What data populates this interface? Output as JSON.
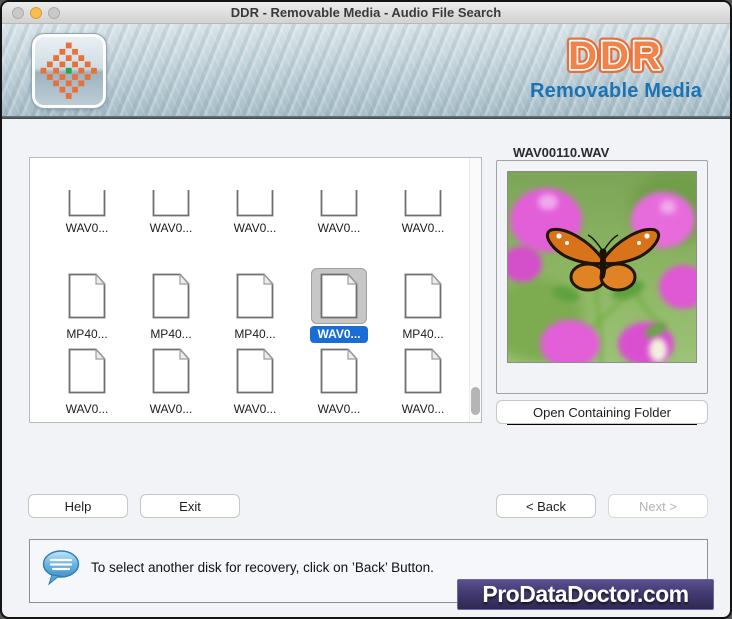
{
  "window": {
    "title": "DDR - Removable Media - Audio File Search"
  },
  "header": {
    "brand": "DDR",
    "subtitle": "Removable Media"
  },
  "file_grid": {
    "rows": [
      {
        "partial": true,
        "items": [
          {
            "label": "WAV0..."
          },
          {
            "label": "WAV0..."
          },
          {
            "label": "WAV0..."
          },
          {
            "label": "WAV0..."
          },
          {
            "label": "WAV0..."
          }
        ]
      },
      {
        "partial": false,
        "items": [
          {
            "label": "MP40..."
          },
          {
            "label": "MP40..."
          },
          {
            "label": "MP40..."
          },
          {
            "label": "WAV0...",
            "selected": true
          },
          {
            "label": "MP40..."
          }
        ]
      },
      {
        "partial": false,
        "items": [
          {
            "label": "WAV0..."
          },
          {
            "label": "WAV0..."
          },
          {
            "label": "WAV0..."
          },
          {
            "label": "WAV0..."
          },
          {
            "label": "WAV0..."
          }
        ]
      }
    ]
  },
  "preview": {
    "filename": "WAV00110.WAV",
    "image_alt": "Orange and black butterfly on pink bougainvillea flowers",
    "open_folder_label": "Open Containing Folder"
  },
  "actions": {
    "help": "Help",
    "exit": "Exit",
    "back": "< Back",
    "next": "Next >",
    "next_enabled": false
  },
  "footer": {
    "message": "To select another disk for recovery, click on ’Back’ Button."
  },
  "branding": {
    "site": "ProDataDoctor.com"
  },
  "colors": {
    "accent_orange": "#e8703a",
    "brand_blue": "#1a73b5",
    "selection_blue": "#1a6dd4",
    "banner_purple": "#423a70",
    "logo_green": "#2fa349"
  },
  "icons": {
    "app-logo-icon": "orange checkered diamond with green center",
    "close-button": "gray circle",
    "minimize-button": "yellow circle",
    "zoom-button": "gray circle",
    "volume-icon": "speaker",
    "pause-icon": "double bars",
    "step-back-icon": "bar + left triangle",
    "step-forward-icon": "right triangle + bar",
    "playhead-icon": "diamond",
    "speech-bubble-icon": "glossy blue speech balloon",
    "document-icon": "white page with folded corner"
  }
}
